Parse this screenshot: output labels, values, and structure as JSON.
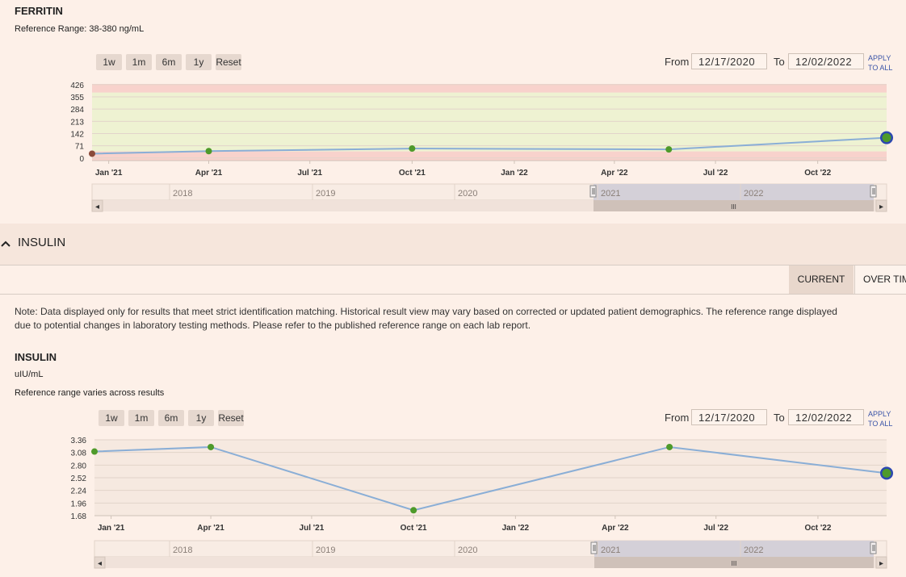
{
  "colors": {
    "line": "#8aaed6",
    "point": "#4e9a2a",
    "first_point": "#8b4a3a",
    "last_point_ring": "#2c48b0",
    "normal_band": "#eef2d2",
    "abnormal_band": "#f8d2cc",
    "plot_bg": "#f6e9e0",
    "navigator_selected": "#d4d0d8"
  },
  "range_buttons": [
    "1w",
    "1m",
    "6m",
    "1y",
    "Reset"
  ],
  "date_range": {
    "from_label": "From",
    "from_value": "12/17/2020",
    "to_label": "To",
    "to_value": "12/02/2022",
    "apply_line1": "APPLY",
    "apply_line2": "TO ALL"
  },
  "ferritin": {
    "title": "FERRITIN",
    "reference": "Reference Range: 38-380 ng/mL"
  },
  "insulin_section": {
    "header": "INSULIN",
    "toggle_icon": "chevron-up-icon",
    "tabs": [
      "CURRENT",
      "OVER TIM"
    ],
    "note_line1": "Note: Data displayed only for results that meet strict identification matching. Historical result view may vary based on corrected or updated patient demographics. The reference range displayed",
    "note_line2": "due to potential changes in laboratory testing methods. Please refer to the published reference range on each lab report.",
    "title": "INSULIN",
    "unit": "uIU/mL",
    "reference": "Reference range varies across results"
  },
  "navigator": {
    "years": [
      "2018",
      "2019",
      "2020",
      "2021",
      "2022"
    ],
    "scroll_left": "◂",
    "scroll_right": "▸",
    "grip": "III"
  },
  "chart_data": [
    {
      "type": "line",
      "title": "FERRITIN",
      "xlabel": "",
      "ylabel": "",
      "x_ticks": [
        "Jan '21",
        "Apr '21",
        "Jul '21",
        "Oct '21",
        "Jan '22",
        "Apr '22",
        "Jul '22",
        "Oct '22"
      ],
      "y_ticks": [
        0,
        71,
        142,
        213,
        284,
        355,
        426
      ],
      "ylim": [
        -15,
        430
      ],
      "xlim": [
        "2020-12-17",
        "2022-12-02"
      ],
      "reference_range": [
        38,
        380
      ],
      "grid": true,
      "series": [
        {
          "x": [
            "2020-12-17",
            "2021-04-01",
            "2021-10-01",
            "2022-05-20",
            "2022-12-02"
          ],
          "y": [
            25,
            40,
            55,
            50,
            118
          ]
        }
      ]
    },
    {
      "type": "line",
      "title": "INSULIN",
      "xlabel": "",
      "ylabel": "uIU/mL",
      "x_ticks": [
        "Jan '21",
        "Apr '21",
        "Jul '21",
        "Oct '21",
        "Jan '22",
        "Apr '22",
        "Jul '22",
        "Oct '22"
      ],
      "y_ticks": [
        1.68,
        1.96,
        2.24,
        2.52,
        2.8,
        3.08,
        3.36
      ],
      "ylim": [
        1.68,
        3.36
      ],
      "xlim": [
        "2020-12-17",
        "2022-12-02"
      ],
      "grid": true,
      "series": [
        {
          "x": [
            "2020-12-17",
            "2021-04-01",
            "2021-10-01",
            "2022-05-20",
            "2022-12-02"
          ],
          "y": [
            3.1,
            3.2,
            1.8,
            3.2,
            2.62
          ]
        }
      ]
    }
  ]
}
